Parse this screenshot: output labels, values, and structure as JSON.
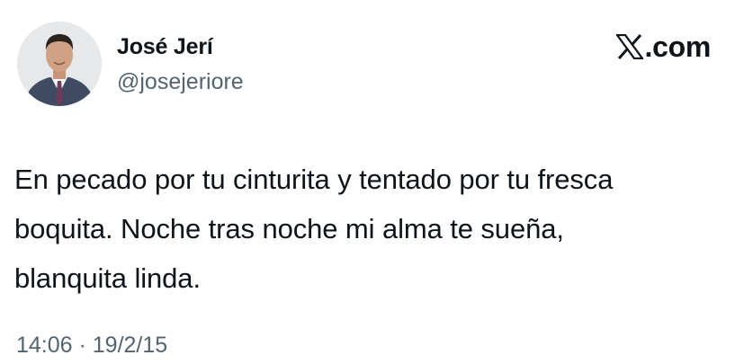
{
  "tweet": {
    "author_name": "José Jerí",
    "author_handle": "@josejeriore",
    "brand": ".com",
    "brand_icon": "x-logo-icon",
    "text_lines": [
      "En pecado por tu cinturita y tentado por tu fresca",
      "boquita. Noche tras noche mi alma te sueña,",
      "blanquita linda."
    ],
    "timestamp": "14:06 · 19/2/15"
  },
  "colors": {
    "text_primary": "#0f1419",
    "text_secondary": "#536471",
    "background": "#ffffff"
  }
}
